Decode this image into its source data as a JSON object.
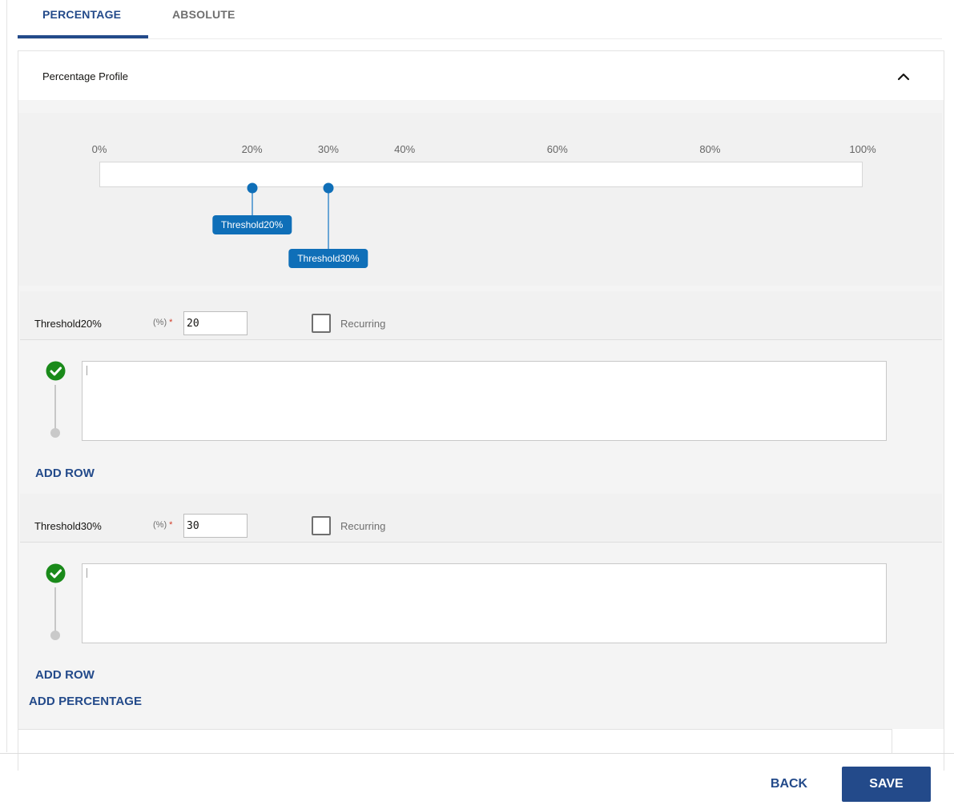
{
  "tabs": [
    {
      "label": "PERCENTAGE",
      "active": true
    },
    {
      "label": "ABSOLUTE",
      "active": false
    }
  ],
  "panel": {
    "title": "Percentage Profile",
    "collapse_icon": "chevron-up-icon"
  },
  "slider": {
    "ticks": [
      {
        "label": "0%",
        "value": 0
      },
      {
        "label": "20%",
        "value": 20
      },
      {
        "label": "30%",
        "value": 30
      },
      {
        "label": "40%",
        "value": 40
      },
      {
        "label": "60%",
        "value": 60
      },
      {
        "label": "80%",
        "value": 80
      },
      {
        "label": "100%",
        "value": 100
      }
    ],
    "markers": [
      {
        "label": "Threshold20%",
        "value": 20
      },
      {
        "label": "Threshold30%",
        "value": 30
      }
    ]
  },
  "thresholds": [
    {
      "name": "Threshold20%",
      "unit": "(%)",
      "required": "*",
      "value": "20",
      "recurring_label": "Recurring",
      "recurring": false,
      "rule_text": "",
      "add_row_label": "ADD ROW"
    },
    {
      "name": "Threshold30%",
      "unit": "(%)",
      "required": "*",
      "value": "30",
      "recurring_label": "Recurring",
      "recurring": false,
      "rule_text": "",
      "add_row_label": "ADD ROW"
    }
  ],
  "add_percentage_label": "ADD PERCENTAGE",
  "footer": {
    "back_label": "BACK",
    "save_label": "SAVE"
  },
  "colors": {
    "accent": "#234a8a",
    "marker": "#0f6fb8",
    "success": "#1a8a1a",
    "required": "#d13b27"
  }
}
